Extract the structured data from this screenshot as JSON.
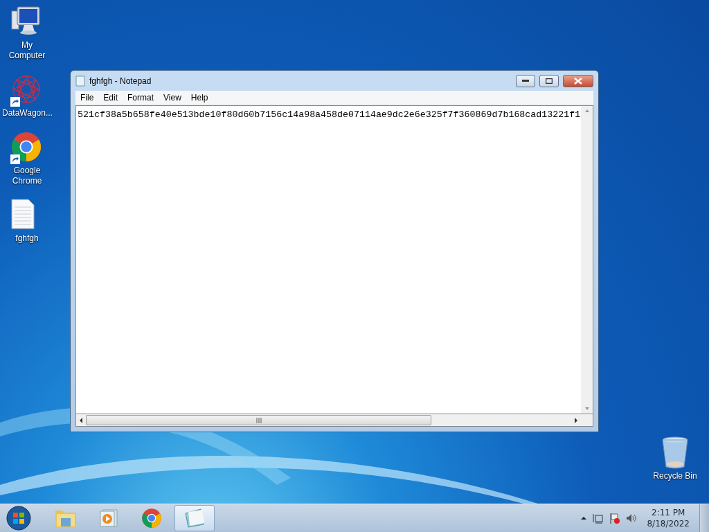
{
  "desktop_icons": [
    {
      "kind": "computer",
      "label": "My Computer",
      "shortcut": false
    },
    {
      "kind": "app",
      "label": "DataWagon...",
      "shortcut": true
    },
    {
      "kind": "chrome",
      "label": "Google Chrome",
      "shortcut": true
    },
    {
      "kind": "document",
      "label": "fghfgh",
      "shortcut": false
    }
  ],
  "recycle_bin": {
    "label": "Recycle Bin"
  },
  "window": {
    "title": "fghfgh - Notepad",
    "menu": [
      "File",
      "Edit",
      "Format",
      "View",
      "Help"
    ],
    "content": "521cf38a5b658fe40e513bde10f80d60b7156c14a98a458de07114ae9dc2e6e325f7f360869d7b168cad13221f1"
  },
  "taskbar": {
    "items": [
      {
        "kind": "explorer",
        "selected": false
      },
      {
        "kind": "media",
        "selected": false
      },
      {
        "kind": "chrome",
        "selected": false
      },
      {
        "kind": "notepad",
        "selected": true
      }
    ],
    "time": "2:11 PM",
    "date": "8/18/2022"
  }
}
